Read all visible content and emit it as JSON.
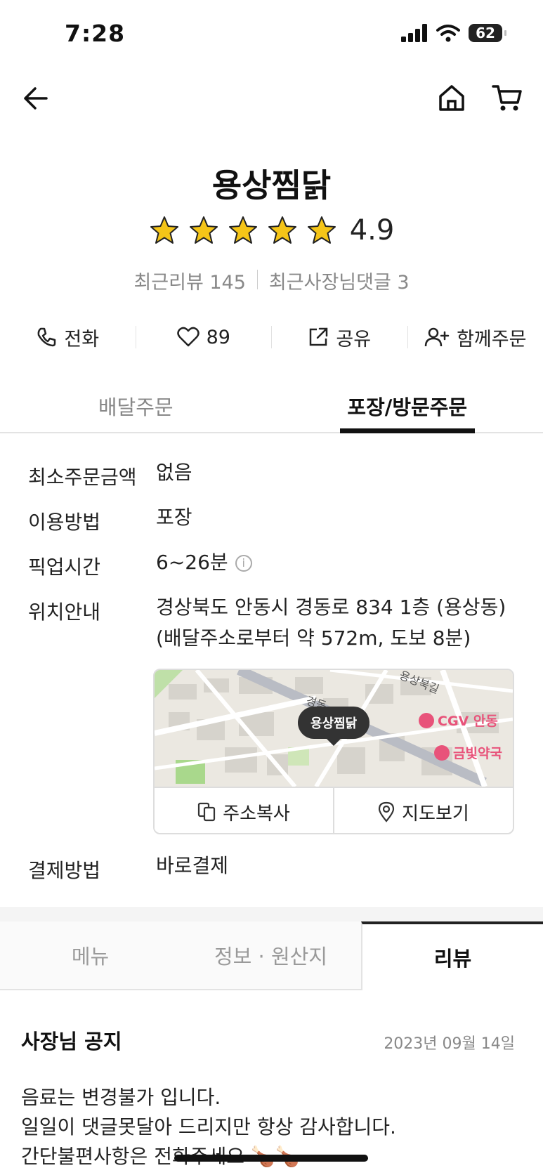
{
  "status_bar": {
    "time": "7:28",
    "battery": "62"
  },
  "header": {
    "back_icon": "arrow-left-icon",
    "home_icon": "home-icon",
    "cart_icon": "cart-icon"
  },
  "store": {
    "name": "용상찜닭",
    "rating": "4.9",
    "rating_value": 4.9,
    "stars": 5,
    "recent_reviews": "최근리뷰 145",
    "owner_comments": "최근사장님댓글 3"
  },
  "actions": [
    {
      "icon": "phone-icon",
      "label": "전화"
    },
    {
      "icon": "heart-icon",
      "label": "89"
    },
    {
      "icon": "share-icon",
      "label": "공유"
    },
    {
      "icon": "add-user-icon",
      "label": "함께주문"
    }
  ],
  "order_tabs": [
    {
      "label": "배달주문",
      "active": false
    },
    {
      "label": "포장/방문주문",
      "active": true
    }
  ],
  "info": {
    "min_order_label": "최소주문금액",
    "min_order_value": "없음",
    "method_label": "이용방법",
    "method_value": "포장",
    "pickup_label": "픽업시간",
    "pickup_value": "6~26분",
    "location_label": "위치안내",
    "location_line1": "경상북도 안동시 경동로 834 1층 (용상동)",
    "location_line2": "(배달주소로부터 약 572m, 도보 8분)",
    "payment_label": "결제방법",
    "payment_value": "바로결제"
  },
  "map": {
    "pin_label": "용상찜닭",
    "poi_cgv": "CGV 안동",
    "poi_pharmacy": "금빛약국",
    "road_top": "용상북길",
    "road_mid": "경동",
    "copy_label": "주소복사",
    "view_label": "지도보기"
  },
  "section_tabs": [
    {
      "label": "메뉴",
      "active": false
    },
    {
      "label": "정보 · 원산지",
      "active": false
    },
    {
      "label": "리뷰",
      "active": true
    }
  ],
  "notice": {
    "title": "사장님 공지",
    "date": "2023년 09월 14일",
    "body": "음료는  변경불가 입니다.\n일일이 댓글못달아 드리지만 항상 감사합니다.\n간단불편사항은 전화주세요 🍗🍗"
  }
}
